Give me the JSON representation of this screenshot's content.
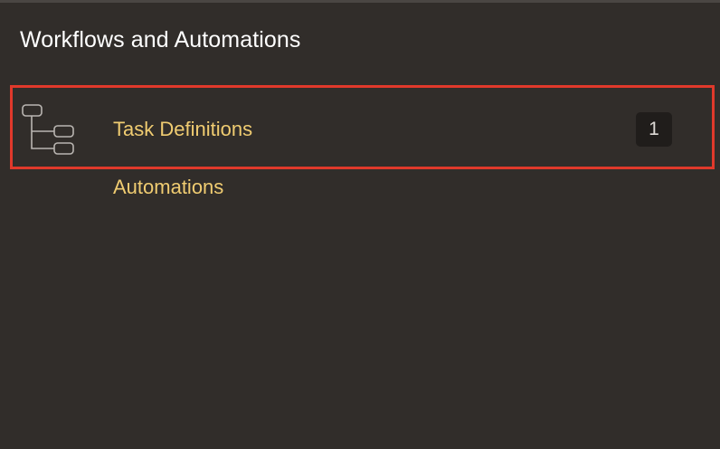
{
  "panel": {
    "title": "Workflows and Automations"
  },
  "items": [
    {
      "label": "Task Definitions",
      "icon": "hierarchy-tree-icon",
      "count": "1",
      "highlighted": true
    },
    {
      "label": "Automations"
    }
  ],
  "colors": {
    "background": "#312d2a",
    "link": "#f0cc71",
    "highlight_border": "#e0392b",
    "badge_bg": "#201d1b"
  }
}
